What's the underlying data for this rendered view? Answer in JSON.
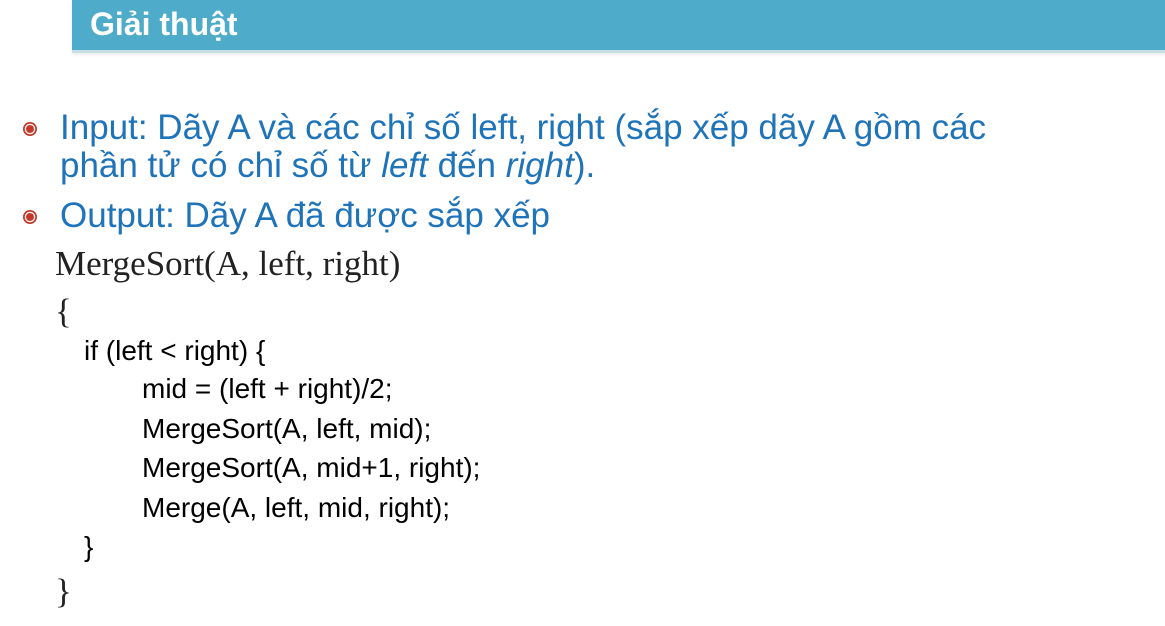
{
  "slide": {
    "title": "Giải thuật"
  },
  "bullets": [
    {
      "line1_prefix": "Input: Dãy A và các chỉ số left, right (sắp xếp dãy A gồm các",
      "line2_part1": "phần tử có chỉ số từ ",
      "line2_italic1": "left",
      "line2_part2": " đến ",
      "line2_italic2": "right",
      "line2_part3": ")."
    },
    {
      "line1_prefix": "Output: Dãy A đã được sắp xếp"
    }
  ],
  "code": {
    "signature": "MergeSort(A, left, right)",
    "open_brace": "{",
    "if_line": "if (left < right) {",
    "mid_line": "mid = (left + right)/2;",
    "ms_left_line": "MergeSort(A, left, mid);",
    "ms_right_line": "MergeSort(A, mid+1, right);",
    "merge_line": "Merge(A, left, mid, right);",
    "inner_close": "}",
    "close_brace": "}"
  },
  "colors": {
    "title_bar": "#4eabc9",
    "bullet_text": "#1e73b9",
    "bullet_marker": "#c0392b"
  }
}
